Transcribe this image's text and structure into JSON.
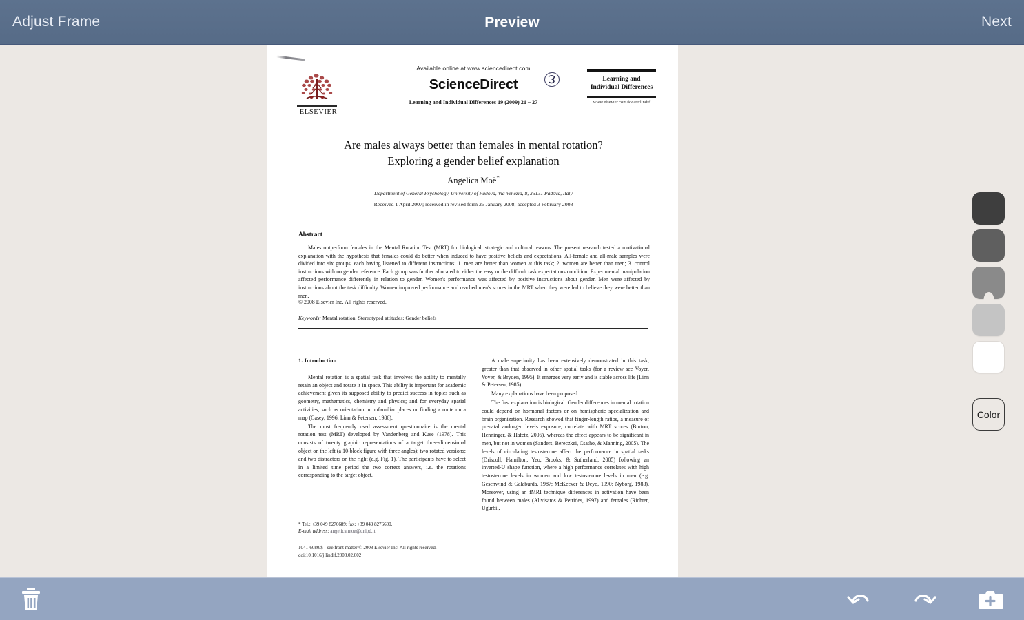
{
  "app": {
    "header": {
      "left_button": "Adjust Frame",
      "title": "Preview",
      "right_button": "Next",
      "bg_color": "#5a6f8b",
      "text_color": "#ffffff"
    },
    "bottom_toolbar": {
      "bg_color": "#94a5c1",
      "buttons": [
        {
          "name": "delete-button",
          "icon": "trash-icon",
          "label": "Delete"
        },
        {
          "name": "undo-button",
          "icon": "undo-icon",
          "label": "Undo"
        },
        {
          "name": "redo-button",
          "icon": "redo-icon",
          "label": "Redo"
        },
        {
          "name": "add-page-button",
          "icon": "add-page-icon",
          "label": "Add Page"
        }
      ]
    },
    "canvas": {
      "bg_color": "#ece8e4"
    },
    "palette": {
      "color_button_label": "Color",
      "selected_index": 2,
      "swatches": [
        {
          "name": "swatch-darkest",
          "hex": "#3e3e3e"
        },
        {
          "name": "swatch-dark",
          "hex": "#5f5f5f"
        },
        {
          "name": "swatch-mid",
          "hex": "#8a8a8a"
        },
        {
          "name": "swatch-light",
          "hex": "#c4c4c4"
        },
        {
          "name": "swatch-white",
          "hex": "#ffffff"
        }
      ]
    }
  },
  "document": {
    "journal_header": {
      "publisher": "ELSEVIER",
      "available_online": "Available online at www.sciencedirect.com",
      "sciencedirect_logo": "ScienceDirect",
      "citation_line": "Learning and Individual Differences 19 (2009) 21 – 27",
      "journal_name_line1": "Learning and",
      "journal_name_line2": "Individual Differences",
      "journal_url": "www.elsevier.com/locate/lindif",
      "handwritten_annotation": "3"
    },
    "title_line1": "Are males always better than females in mental rotation?",
    "title_line2": "Exploring a gender belief explanation",
    "author": "Angelica Moè",
    "author_marker": "*",
    "affiliation": "Department of General Psychology, University of Padova, Via Venezia, 8, 35131 Padova, Italy",
    "received": "Received 1 April 2007; received in revised form 26 January 2008; accepted 3 February 2008",
    "abstract": {
      "heading": "Abstract",
      "body": "Males outperform females in the Mental Rotation Test (MRT) for biological, strategic and cultural reasons. The present research tested a motivational explanation with the hypothesis that females could do better when induced to have positive beliefs and expectations. All-female and all-male samples were divided into six groups, each having listened to different instructions: 1. men are better than women at this task; 2. women are better than men; 3. control instructions with no gender reference. Each group was further allocated to either the easy or the difficult task expectations condition. Experimental manipulation affected performance differently in relation to gender. Women's performance was affected by positive instructions about gender. Men were affected by instructions about the task difficulty. Women improved performance and reached men's scores in the MRT when they were led to believe they were better than men.",
      "copyright": "© 2008 Elsevier Inc. All rights reserved.",
      "keywords_label": "Keywords:",
      "keywords_value": "Mental rotation; Stereotyped attitudes; Gender beliefs"
    },
    "body": {
      "section_heading": "1. Introduction",
      "left_column": [
        "Mental rotation is a spatial task that involves the ability to mentally retain an object and rotate it in space. This ability is important for academic achievement given its supposed ability to predict success in topics such as geometry, mathematics, chemistry and physics; and for everyday spatial activities, such as orientation in unfamiliar places or finding a route on a map (Casey, 1996; Linn & Petersen, 1986).",
        "The most frequently used assessment questionnaire is the mental rotation test (MRT) developed by Vandenberg and Kuse (1978). This consists of twenty graphic representations of a target three-dimensional object on the left (a 10-block figure with three angles); two rotated versions; and two distractors on the right (e.g. Fig. 1). The participants have to select in a limited time period the two correct answers, i.e. the rotations corresponding to the target object."
      ],
      "right_column": [
        "A male superiority has been extensively demonstrated in this task, greater than that observed in other spatial tasks (for a review see Voyer, Voyer, & Bryden, 1995). It emerges very early and is stable across life (Linn & Petersen, 1985).",
        "Many explanations have been proposed.",
        "The first explanation is biological. Gender differences in mental rotation could depend on hormonal factors or on hemispheric specialization and brain organization. Research showed that finger-length ratios, a measure of prenatal androgen levels exposure, correlate with MRT scores (Burton, Henninger, & Hafetz, 2005), whereas the effect appears to be significant in men, but not in women (Sanders, Bereczkei, Csatho, & Manning, 2005). The levels of circulating testosterone affect the performance in spatial tasks (Driscoll, Hamilton, Yeo, Brooks, & Sutherland, 2005) following an inverted-U shape function, where a high performance correlates with high testosterone levels in women and low testosterone levels in men (e.g. Geschwind & Galaburda, 1987; McKeever & Deyo, 1990; Nyborg, 1983). Moreover, using an fMRI technique differences in activation have been found between males (Alivisatos & Petrides, 1997) and females (Richter, Ugurbil,"
      ]
    },
    "footnote": {
      "marker": "*",
      "tel": "Tel.: +39 049 8276689; fax: +39 049 8276600.",
      "email_label": "E-mail address:",
      "email_value": "angelica.moe@unipd.it.",
      "issn_line": "1041-6080/$ - see front matter © 2008 Elsevier Inc. All rights reserved.",
      "doi_line": "doi:10.1016/j.lindif.2008.02.002"
    }
  }
}
